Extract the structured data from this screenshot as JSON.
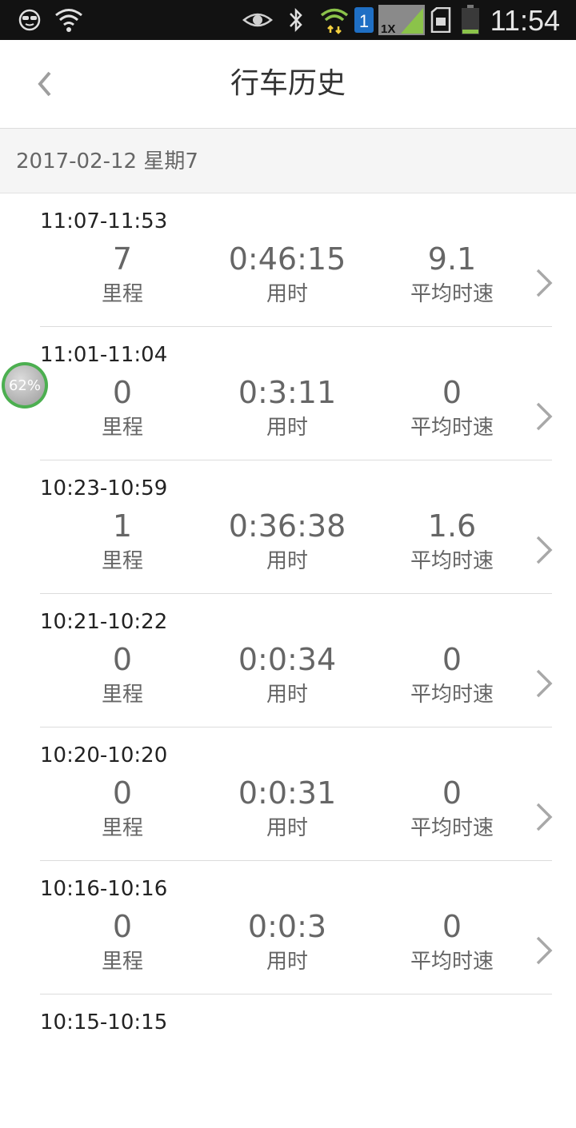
{
  "status_bar": {
    "time": "11:54",
    "network_badge": "1",
    "signal_label": "1X",
    "icons": [
      "sunglasses-face-icon",
      "wifi-question-icon",
      "eye-icon",
      "bluetooth-icon",
      "wifi-data-icon",
      "sim-badge-icon",
      "signal-icon",
      "sd-card-icon",
      "battery-icon"
    ]
  },
  "header": {
    "title": "行车历史",
    "back_icon": "chevron-left-icon"
  },
  "date_header": "2017-02-12 星期7",
  "labels": {
    "distance": "里程",
    "duration": "用时",
    "avg_speed": "平均时速"
  },
  "trips": [
    {
      "time_range": "11:07-11:53",
      "distance": "7",
      "duration": "0:46:15",
      "avg_speed": "9.1"
    },
    {
      "time_range": "11:01-11:04",
      "distance": "0",
      "duration": "0:3:11",
      "avg_speed": "0"
    },
    {
      "time_range": "10:23-10:59",
      "distance": "1",
      "duration": "0:36:38",
      "avg_speed": "1.6"
    },
    {
      "time_range": "10:21-10:22",
      "distance": "0",
      "duration": "0:0:34",
      "avg_speed": "0"
    },
    {
      "time_range": "10:20-10:20",
      "distance": "0",
      "duration": "0:0:31",
      "avg_speed": "0"
    },
    {
      "time_range": "10:16-10:16",
      "distance": "0",
      "duration": "0:0:3",
      "avg_speed": "0"
    },
    {
      "time_range": "10:15-10:15"
    }
  ],
  "floating_bubble": {
    "percent": "62%"
  },
  "colors": {
    "status_bar_bg": "#121212",
    "accent_green": "#4caf50",
    "text_gray": "#666666",
    "divider": "#dcdcdc"
  }
}
